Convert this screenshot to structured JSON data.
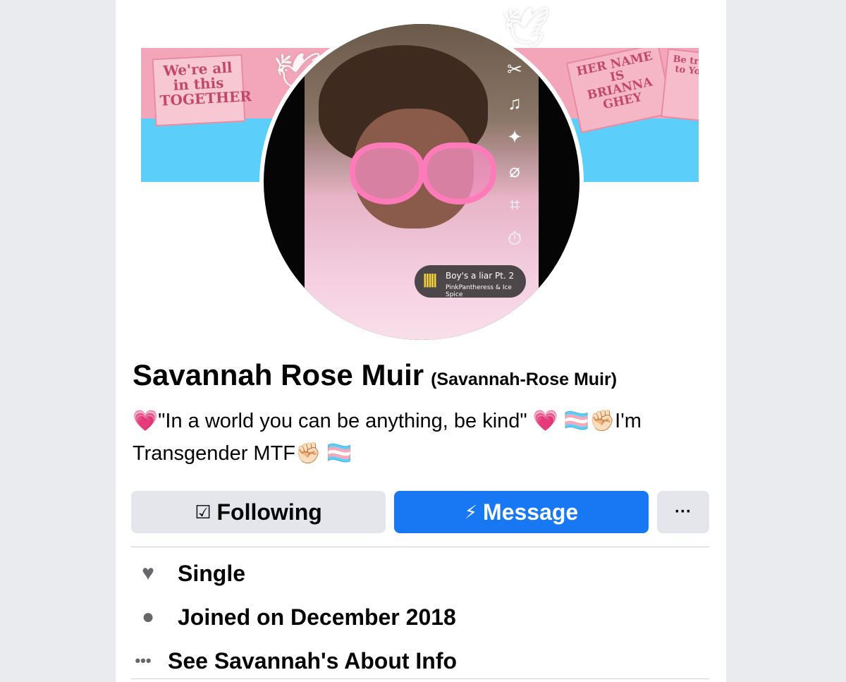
{
  "cover": {
    "sign_left": "We're all in this TOGETHER",
    "sign_right": "HER NAME IS BRIANNA GHEY",
    "sign_right2": "Be true to You"
  },
  "avatar": {
    "song_title": "Boy's a liar Pt. 2",
    "song_artist": "PinkPantheress & Ice Spice",
    "side_icons": [
      "scissors-icon",
      "music-note-icon",
      "sparkle-search-icon",
      "paperclip-icon",
      "crop-icon",
      "timer-icon"
    ]
  },
  "profile": {
    "name": "Savannah Rose Muir",
    "alt_name": "(Savannah-Rose Muir)",
    "bio_line1": "💗\"In a world you can be anything, be kind\" 💗 🏳️‍⚧️✊🏻I'm",
    "bio_line2": "Transgender MTF✊🏻 🏳️‍⚧️"
  },
  "actions": {
    "following_label": "Following",
    "message_label": "Message",
    "more_label": "···"
  },
  "info": {
    "relationship": "Single",
    "joined": "Joined on December 2018",
    "about_link": "See Savannah's About Info"
  },
  "colors": {
    "brand_blue": "#1877f2",
    "button_gray": "#e4e6eb",
    "trans_pink": "#f5a9b8",
    "trans_blue": "#5bcefa"
  }
}
